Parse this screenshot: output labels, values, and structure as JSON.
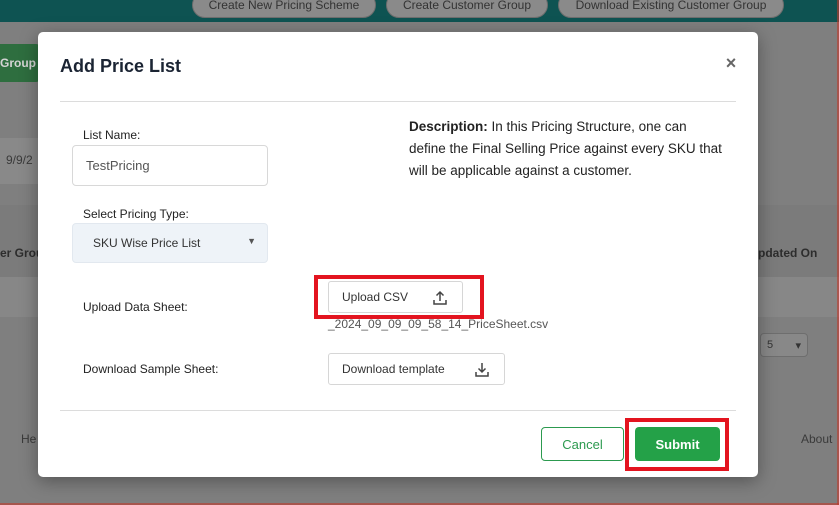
{
  "background": {
    "top_buttons": [
      "Create New Pricing Scheme",
      "Create Customer Group",
      "Download Existing Customer Group"
    ],
    "side_button": "Group",
    "date_text": "9/9/2",
    "col_left": "er Grou",
    "col_right": "pdated On",
    "pager_value": "5",
    "help_text": "He",
    "about_text": "About"
  },
  "modal": {
    "title": "Add Price List",
    "close_label": "×",
    "list_name": {
      "label": "List Name:",
      "value": "TestPricing"
    },
    "pricing_type": {
      "label": "Select Pricing Type:",
      "selected": "SKU Wise Price List"
    },
    "description": {
      "heading": "Description:",
      "text": " In this Pricing Structure, one can define the Final Selling Price against every SKU that will be applicable against a customer."
    },
    "upload": {
      "label": "Upload Data Sheet:",
      "button_label": "Upload CSV",
      "file_name": "_2024_09_09_09_58_14_PriceSheet.csv"
    },
    "download": {
      "label": "Download Sample Sheet:",
      "button_label": "Download template"
    },
    "cancel_label": "Cancel",
    "submit_label": "Submit"
  },
  "colors": {
    "accent_green": "#24a148",
    "highlight_red": "#e3141f",
    "header_teal": "#0e5352"
  },
  "icons": {
    "upload": "upload-icon",
    "download": "download-icon",
    "close": "close-icon",
    "dropdown": "chevron-down-icon"
  }
}
